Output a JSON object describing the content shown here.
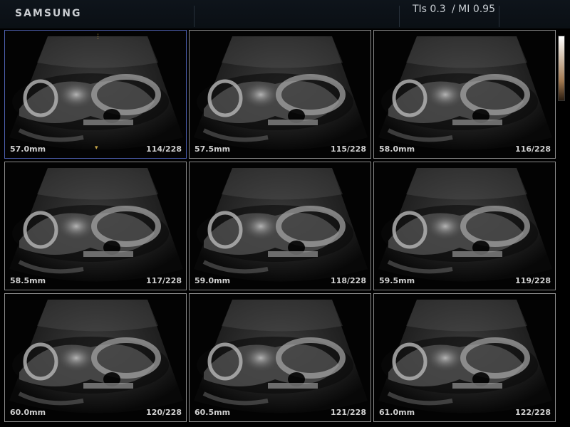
{
  "header": {
    "brand": "SAMSUNG",
    "tis": "TIs 0.3",
    "mi": "/ MI 0.95"
  },
  "frames": [
    {
      "depth": "57.0mm",
      "frame": "114/228"
    },
    {
      "depth": "57.5mm",
      "frame": "115/228"
    },
    {
      "depth": "58.0mm",
      "frame": "116/228"
    },
    {
      "depth": "58.5mm",
      "frame": "117/228"
    },
    {
      "depth": "59.0mm",
      "frame": "118/228"
    },
    {
      "depth": "59.5mm",
      "frame": "119/228"
    },
    {
      "depth": "60.0mm",
      "frame": "120/228"
    },
    {
      "depth": "60.5mm",
      "frame": "121/228"
    },
    {
      "depth": "61.0mm",
      "frame": "122/228"
    }
  ],
  "active_frame_index": 0,
  "icons": {
    "gray_scale_bar": "grayscale-bar-icon",
    "depth_marker": "depth-marker-icon"
  }
}
